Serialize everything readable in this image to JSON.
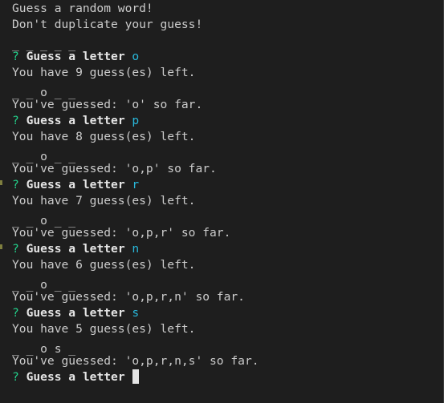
{
  "intro": {
    "line1": "Guess a random word!",
    "line2": "Don't duplicate your guess!"
  },
  "initial_pattern": "_ _ _ _ _",
  "prompt": {
    "marker": "?",
    "label": "Guess a letter"
  },
  "turns": [
    {
      "answer": "o",
      "left": "You have 9 guess(es) left.",
      "pattern": "_ _ o _ _",
      "guessed": "You've guessed: 'o' so far."
    },
    {
      "answer": "p",
      "left": "You have 8 guess(es) left.",
      "pattern": "_ _ o _ _",
      "guessed": "You've guessed: 'o,p' so far."
    },
    {
      "answer": "r",
      "left": "You have 7 guess(es) left.",
      "pattern": "_ _ o _ _",
      "guessed": "You've guessed: 'o,p,r' so far."
    },
    {
      "answer": "n",
      "left": "You have 6 guess(es) left.",
      "pattern": "_ _ o _ _",
      "guessed": "You've guessed: 'o,p,r,n' so far."
    },
    {
      "answer": "s",
      "left": "You have 5 guess(es) left.",
      "pattern": "_ _ o s _",
      "guessed": "You've guessed: 'o,p,r,n,s' so far."
    }
  ],
  "colors": {
    "background": "#1e1e1e",
    "text": "#cccccc",
    "prompt_marker": "#23d18b",
    "answer": "#29b8db"
  }
}
